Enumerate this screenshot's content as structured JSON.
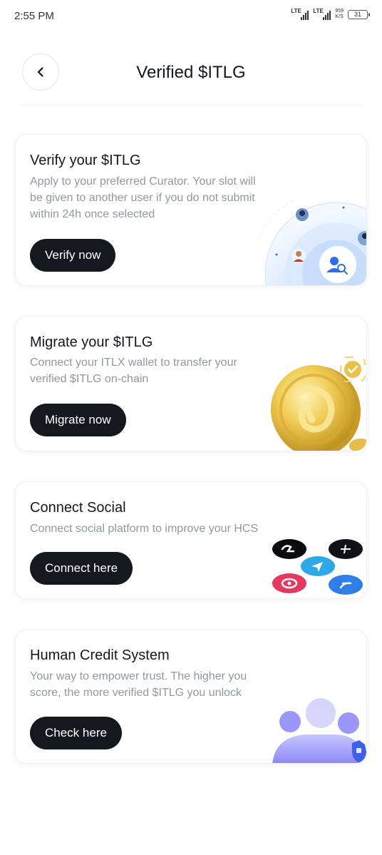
{
  "status_bar": {
    "time": "2:55 PM",
    "signal1_label": "LTE",
    "signal2_label": "LTE",
    "speed_value": "959",
    "speed_unit": "K/S",
    "battery": "31"
  },
  "header": {
    "title": "Verified $ITLG",
    "back_icon": "chevron-left-icon"
  },
  "cards": [
    {
      "title": "Verify your $ITLG",
      "description_lines": [
        "Apply to your preferred Curator. Your slot will",
        "be given to another user if you do not submit",
        "within 24h once selected"
      ],
      "button": "Verify now",
      "illustration": "user-search-radar-illustration"
    },
    {
      "title": "Migrate your $ITLG",
      "description_lines": [
        "Connect your ITLX wallet to transfer your",
        "verified $ITLG on-chain"
      ],
      "button": "Migrate now",
      "illustration": "gold-coin-illustration"
    },
    {
      "title": "Connect Social",
      "description_lines": [
        "Connect social platform to improve your HCS"
      ],
      "button": "Connect here",
      "illustration": "social-platform-badges-illustration"
    },
    {
      "title": "Human Credit System",
      "description_lines": [
        "Your way to empower trust. The higher you",
        "score, the more verified $ITLG you unlock"
      ],
      "button": "Check here",
      "illustration": "people-shield-illustration"
    }
  ],
  "colors": {
    "button_bg": "#14181f",
    "text_primary": "#14171f",
    "text_secondary": "#9297a2",
    "accent_blue": "#3b82f6",
    "gold": "#e2b93b"
  }
}
